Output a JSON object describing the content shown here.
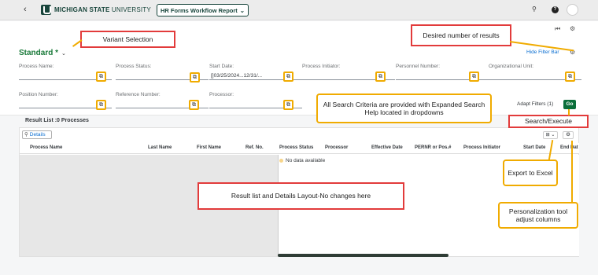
{
  "shell": {
    "back_glyph": "‹",
    "logo_text_bold": "MICHIGAN STATE",
    "logo_text_light": " UNIVERSITY",
    "app_title": "HR Forms Workflow Report",
    "app_title_chevron": "⌄",
    "search_glyph": "⚲",
    "help_glyph": "?"
  },
  "subbar": {
    "skip_glyph": "⏮",
    "settings_glyph": "⚙"
  },
  "filterbar": {
    "variant_name": "Standard *",
    "variant_chevron": "⌄",
    "hide_filter_bar": "Hide Filter Bar",
    "settings_glyph": "⚙",
    "value_help_glyph": "⧉",
    "clear_glyph": "×",
    "fields": {
      "process_name": {
        "label": "Process Name:",
        "value": ""
      },
      "process_status": {
        "label": "Process Status:",
        "value": ""
      },
      "start_date": {
        "label": "Start Date:",
        "value": "[]03/25/2024...12/31/..."
      },
      "process_initiator": {
        "label": "Process Initiator:",
        "value": ""
      },
      "personnel_number": {
        "label": "Personnel Number:",
        "value": ""
      },
      "organizational_unit": {
        "label": "Organizational Unit:",
        "value": ""
      },
      "position_number": {
        "label": "Position Number:",
        "value": ""
      },
      "reference_number": {
        "label": "Reference Number:",
        "value": ""
      },
      "processor": {
        "label": "Processor:",
        "value": ""
      }
    },
    "adapt_filters": "Adapt Filters (1)",
    "go": "Go"
  },
  "results": {
    "title": "Result List :0 Processes",
    "details_label": "Details",
    "search_glyph": "⚲",
    "export_glyph": "⊞ ⌄",
    "settings_glyph": "⚙",
    "columns": {
      "process_name": "Process Name",
      "last_name": "Last Name",
      "first_name": "First Name",
      "ref_no": "Ref. No.",
      "process_status": "Process Status",
      "processor": "Processor",
      "effective_date": "Effective Date",
      "pernr_pos": "PERNR or Pos.#",
      "process_initiator": "Process Initiator",
      "start_date": "Start Date",
      "end_date": "End Dat"
    },
    "no_data": "No data available"
  },
  "annotations": {
    "variant_selection": "Variant Selection",
    "desired_results": "Desired number of results",
    "search_criteria": "All Search Criteria are provided with Expanded Search Help located in dropdowns",
    "search_execute": "Search/Execute",
    "export_excel": "Export to Excel",
    "result_layout": "Result list and Details Layout-No changes here",
    "personalization": "Personalization tool adjust columns"
  },
  "colors": {
    "brand_green": "#18453b",
    "go_green": "#0a6e3a",
    "callout_red": "#e23b3b",
    "callout_orange": "#f0ab00"
  }
}
